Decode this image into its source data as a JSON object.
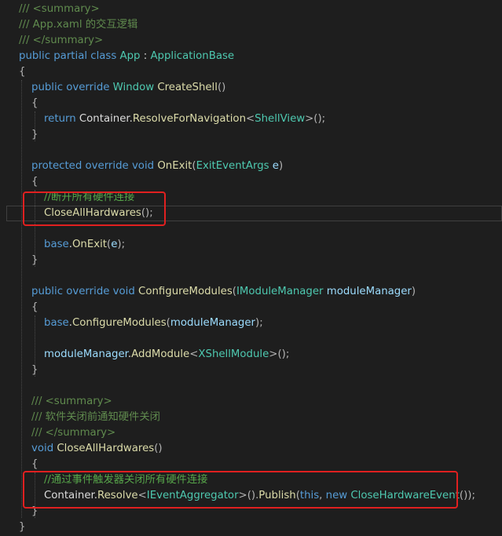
{
  "theme": {
    "background": "#1e1e1e",
    "colors": {
      "comment": "#57a64a",
      "doc": "#608b4e",
      "keyword": "#569cd6",
      "type": "#4ec9b0",
      "ident": "#dcdcdc",
      "method": "#dcdcaa",
      "param": "#9cdcfe",
      "punct": "#b4b4b4",
      "highlight": "#e02020"
    }
  },
  "code_lines": [
    [
      [
        "doc",
        "/// <summary>"
      ]
    ],
    [
      [
        "doc",
        "/// App.xaml 的交互逻辑"
      ]
    ],
    [
      [
        "doc",
        "/// </summary>"
      ]
    ],
    [
      [
        "keyword",
        "public partial class "
      ],
      [
        "type",
        "App"
      ],
      [
        "ident",
        " : "
      ],
      [
        "type",
        "ApplicationBase"
      ]
    ],
    [
      [
        "punct",
        "{"
      ]
    ],
    [
      [
        "keyword",
        "public override "
      ],
      [
        "type",
        "Window "
      ],
      [
        "method",
        "CreateShell"
      ],
      [
        "punct",
        "()"
      ]
    ],
    [
      [
        "punct",
        "{"
      ]
    ],
    [
      [
        "keyword",
        "return "
      ],
      [
        "ident",
        "Container."
      ],
      [
        "method",
        "ResolveForNavigation"
      ],
      [
        "punct",
        "<"
      ],
      [
        "type",
        "ShellView"
      ],
      [
        "punct",
        ">();"
      ]
    ],
    [
      [
        "punct",
        "}"
      ]
    ],
    [],
    [
      [
        "keyword",
        "protected override void "
      ],
      [
        "method",
        "OnExit"
      ],
      [
        "punct",
        "("
      ],
      [
        "type",
        "ExitEventArgs "
      ],
      [
        "param",
        "e"
      ],
      [
        "punct",
        ")"
      ]
    ],
    [
      [
        "punct",
        "{"
      ]
    ],
    [
      [
        "comment",
        "//断开所有硬件连接"
      ]
    ],
    [
      [
        "method",
        "CloseAllHardwares"
      ],
      [
        "punct",
        "();"
      ]
    ],
    [],
    [
      [
        "keyword",
        "base"
      ],
      [
        "ident",
        "."
      ],
      [
        "method",
        "OnExit"
      ],
      [
        "punct",
        "("
      ],
      [
        "param",
        "e"
      ],
      [
        "punct",
        ");"
      ]
    ],
    [
      [
        "punct",
        "}"
      ]
    ],
    [],
    [
      [
        "keyword",
        "public override void "
      ],
      [
        "method",
        "ConfigureModules"
      ],
      [
        "punct",
        "("
      ],
      [
        "type",
        "IModuleManager "
      ],
      [
        "param",
        "moduleManager"
      ],
      [
        "punct",
        ")"
      ]
    ],
    [
      [
        "punct",
        "{"
      ]
    ],
    [
      [
        "keyword",
        "base"
      ],
      [
        "ident",
        "."
      ],
      [
        "method",
        "ConfigureModules"
      ],
      [
        "punct",
        "("
      ],
      [
        "param",
        "moduleManager"
      ],
      [
        "punct",
        ");"
      ]
    ],
    [],
    [
      [
        "param",
        "moduleManager"
      ],
      [
        "ident",
        "."
      ],
      [
        "method",
        "AddModule"
      ],
      [
        "punct",
        "<"
      ],
      [
        "type",
        "XShellModule"
      ],
      [
        "punct",
        ">();"
      ]
    ],
    [
      [
        "punct",
        "}"
      ]
    ],
    [],
    [
      [
        "doc",
        "/// <summary>"
      ]
    ],
    [
      [
        "doc",
        "/// 软件关闭前通知硬件关闭"
      ]
    ],
    [
      [
        "doc",
        "/// </summary>"
      ]
    ],
    [
      [
        "keyword",
        "void "
      ],
      [
        "method",
        "CloseAllHardwares"
      ],
      [
        "punct",
        "()"
      ]
    ],
    [
      [
        "punct",
        "{"
      ]
    ],
    [
      [
        "comment",
        "//通过事件触发器关闭所有硬件连接"
      ]
    ],
    [
      [
        "ident",
        "Container."
      ],
      [
        "method",
        "Resolve"
      ],
      [
        "punct",
        "<"
      ],
      [
        "type",
        "IEventAggregator"
      ],
      [
        "punct",
        ">()."
      ],
      [
        "method",
        "Publish"
      ],
      [
        "punct",
        "("
      ],
      [
        "keyword",
        "this"
      ],
      [
        "punct",
        ", "
      ],
      [
        "keyword",
        "new "
      ],
      [
        "type",
        "CloseHardwareEvent"
      ],
      [
        "punct",
        "());"
      ]
    ],
    [
      [
        "punct",
        "}"
      ]
    ],
    [
      [
        "punct",
        "}"
      ]
    ]
  ]
}
